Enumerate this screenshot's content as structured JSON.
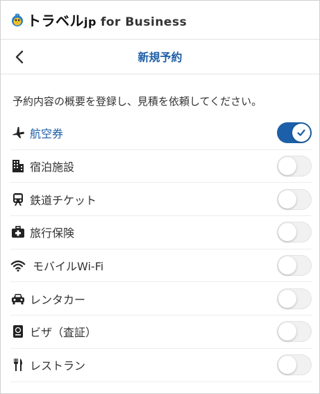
{
  "brand": {
    "name": "トラベル",
    "suffix": "jp",
    "sub": "for Business"
  },
  "nav": {
    "title": "新規予約"
  },
  "description": "予約内容の概要を登録し、見積を依頼してください。",
  "colors": {
    "accent": "#1f5fa6",
    "toggle_on": "#1d5fa8",
    "toggle_off": "#f1f1f1"
  },
  "options": [
    {
      "label": "航空券",
      "icon": "airplane-icon",
      "enabled": true
    },
    {
      "label": "宿泊施設",
      "icon": "building-icon",
      "enabled": false
    },
    {
      "label": "鉄道チケット",
      "icon": "train-icon",
      "enabled": false
    },
    {
      "label": "旅行保険",
      "icon": "first-aid-kit-icon",
      "enabled": false
    },
    {
      "label": "モバイルWi-Fi",
      "icon": "wifi-icon",
      "enabled": false
    },
    {
      "label": "レンタカー",
      "icon": "car-icon",
      "enabled": false
    },
    {
      "label": "ビザ（査証）",
      "icon": "passport-icon",
      "enabled": false
    },
    {
      "label": "レストラン",
      "icon": "fork-knife-icon",
      "enabled": false
    }
  ]
}
